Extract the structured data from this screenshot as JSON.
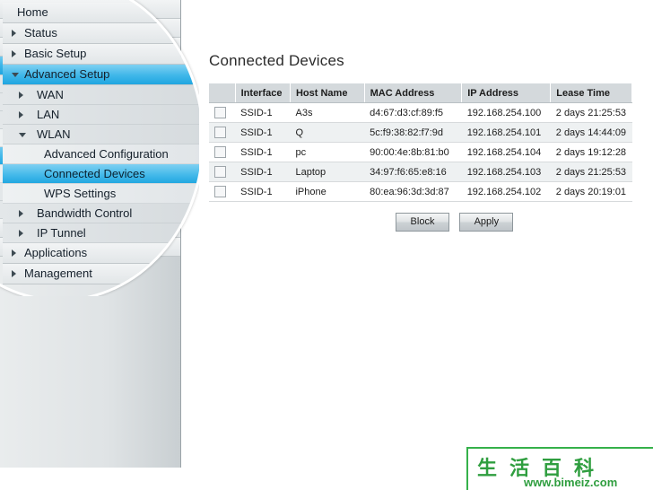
{
  "sidebar": {
    "items": [
      {
        "label": "Home",
        "level": "top",
        "icon": "none",
        "state": "normal"
      },
      {
        "label": "Status",
        "level": "l1",
        "icon": "chevron-right-icon",
        "state": "normal"
      },
      {
        "label": "Basic Setup",
        "level": "l1",
        "icon": "chevron-right-icon",
        "state": "normal"
      },
      {
        "label": "Advanced Setup",
        "level": "l1",
        "icon": "chevron-down-icon",
        "state": "selected"
      },
      {
        "label": "WAN",
        "level": "l2",
        "icon": "chevron-right-icon",
        "state": "normal"
      },
      {
        "label": "LAN",
        "level": "l2",
        "icon": "chevron-right-icon",
        "state": "normal"
      },
      {
        "label": "WLAN",
        "level": "l2",
        "icon": "chevron-down-icon",
        "state": "open"
      },
      {
        "label": "Advanced Configuration",
        "level": "l3",
        "icon": "none",
        "state": "normal"
      },
      {
        "label": "Connected Devices",
        "level": "l3",
        "icon": "none",
        "state": "active"
      },
      {
        "label": "WPS Settings",
        "level": "l3",
        "icon": "none",
        "state": "normal"
      },
      {
        "label": "Bandwidth Control",
        "level": "l2",
        "icon": "chevron-right-icon",
        "state": "normal"
      },
      {
        "label": "IP Tunnel",
        "level": "l2",
        "icon": "chevron-right-icon",
        "state": "normal"
      },
      {
        "label": "Applications",
        "level": "l1",
        "icon": "chevron-right-icon",
        "state": "normal"
      },
      {
        "label": "Management",
        "level": "l1",
        "icon": "chevron-right-icon",
        "state": "normal"
      }
    ]
  },
  "main": {
    "title": "Connected Devices",
    "table": {
      "columns": [
        "",
        "Interface",
        "Host Name",
        "MAC Address",
        "IP Address",
        "Lease Time"
      ],
      "rows": [
        {
          "checked": false,
          "interface": "SSID-1",
          "host": "A3s",
          "mac": "d4:67:d3:cf:89:f5",
          "ip": "192.168.254.100",
          "lease": "2 days 21:25:53"
        },
        {
          "checked": false,
          "interface": "SSID-1",
          "host": "Q",
          "mac": "5c:f9:38:82:f7:9d",
          "ip": "192.168.254.101",
          "lease": "2 days 14:44:09"
        },
        {
          "checked": false,
          "interface": "SSID-1",
          "host": "pc",
          "mac": "90:00:4e:8b:81:b0",
          "ip": "192.168.254.104",
          "lease": "2 days 19:12:28"
        },
        {
          "checked": false,
          "interface": "SSID-1",
          "host": "Laptop",
          "mac": "34:97:f6:65:e8:16",
          "ip": "192.168.254.103",
          "lease": "2 days 21:25:53"
        },
        {
          "checked": false,
          "interface": "SSID-1",
          "host": "iPhone",
          "mac": "80:ea:96:3d:3d:87",
          "ip": "192.168.254.102",
          "lease": "2 days 20:19:01"
        }
      ]
    },
    "buttons": {
      "block": "Block",
      "apply": "Apply"
    }
  },
  "watermark": {
    "logo": "生活百科",
    "url": "www.bimeiz.com",
    "color": "#2f9e3f"
  }
}
